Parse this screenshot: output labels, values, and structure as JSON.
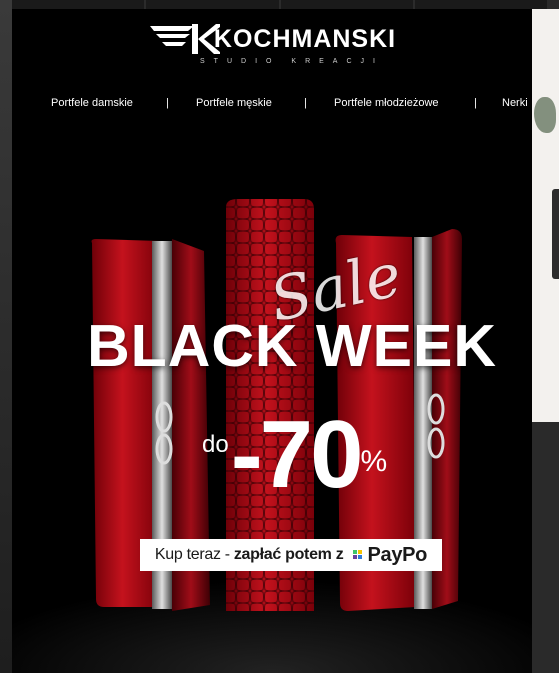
{
  "brand": {
    "name": "KOCHMANSKI",
    "tagline": "STUDIO KREACJI"
  },
  "nav": {
    "items": [
      {
        "label": "Portfele damskie"
      },
      {
        "label": "Portfele męskie"
      },
      {
        "label": "Portfele młodzieżowe"
      },
      {
        "label": "Nerki"
      }
    ],
    "separator": "|"
  },
  "banner": {
    "script_text": "Sale",
    "headline": "BLACK WEEK",
    "discount_prefix": "do",
    "discount_value": "-70",
    "discount_unit": "%",
    "cta_prefix": "Kup teraz -",
    "cta_bold": "zapłać potem z",
    "cta_brand": "PayPo"
  },
  "colors": {
    "background": "#000000",
    "wallet_red": "#b0101a",
    "text": "#ffffff",
    "paypo_green": "#3fc46b",
    "paypo_yellow": "#f5c400",
    "paypo_purple": "#6b3fa0",
    "paypo_blue": "#2f7bd9"
  }
}
